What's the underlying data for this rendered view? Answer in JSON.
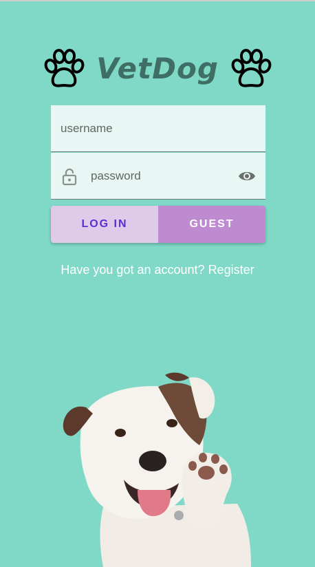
{
  "app": {
    "title": "VetDog"
  },
  "form": {
    "username_placeholder": "username",
    "password_placeholder": "password"
  },
  "buttons": {
    "login_label": "LOG IN",
    "guest_label": "GUEST"
  },
  "register": {
    "prompt": "Have you got an account?",
    "link_label": "Register"
  },
  "icons": {
    "paw_left": "paw-icon",
    "paw_right": "paw-icon",
    "lock": "lock-icon",
    "eye": "eye-icon"
  },
  "colors": {
    "background": "#80d9c6",
    "title": "#3f6f64",
    "field_bg": "#e8f7f3",
    "login_bg": "#e0cae9",
    "login_text": "#5a2dd6",
    "guest_bg": "#bf8bd0"
  }
}
